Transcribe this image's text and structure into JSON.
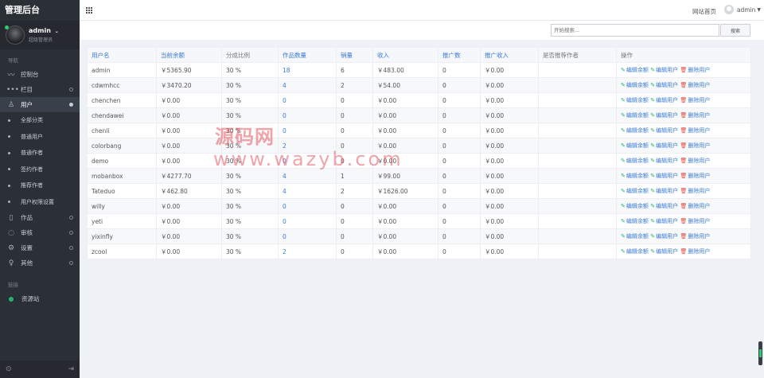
{
  "sidebar": {
    "brand": "管理后台",
    "profile": {
      "name": "admin",
      "role": "超级管理员"
    },
    "section_nav": "导航",
    "section_links": "链接",
    "items": [
      {
        "label": "控制台",
        "icon": "chart-line-icon"
      },
      {
        "label": "栏目",
        "icon": "dots-icon"
      },
      {
        "label": "用户",
        "icon": "user-icon"
      },
      {
        "label": "作品",
        "icon": "book-icon"
      },
      {
        "label": "审核",
        "icon": "circle-notch-icon"
      },
      {
        "label": "设置",
        "icon": "gear-icon"
      },
      {
        "label": "其他",
        "icon": "bulb-icon"
      }
    ],
    "user_subitems": [
      "全部分类",
      "普通用户",
      "普通作者",
      "签约作者",
      "推荐作者",
      "用户权限设置"
    ],
    "links": [
      {
        "label": "资源站"
      }
    ]
  },
  "topbar": {
    "home": "网站首页",
    "user": "admin"
  },
  "search": {
    "placeholder": "开始搜索...",
    "button": "搜索"
  },
  "table": {
    "headers": [
      "用户名",
      "当前余额",
      "分成比例",
      "作品数量",
      "销量",
      "收入",
      "推广数",
      "推广收入",
      "是否推荐作者",
      "操作"
    ],
    "actions": {
      "edit_balance": "编辑余额",
      "edit_user": "编辑用户",
      "delete_user": "删除用户"
    },
    "rows": [
      {
        "username": "admin",
        "balance": "￥5365.90",
        "ratio": "30 %",
        "works": "18",
        "sales": "6",
        "income": "￥483.00",
        "promo": "0",
        "promo_income": "￥0.00",
        "recommended": ""
      },
      {
        "username": "cdwmhcc",
        "balance": "￥3470.20",
        "ratio": "30 %",
        "works": "4",
        "sales": "2",
        "income": "￥54.00",
        "promo": "0",
        "promo_income": "￥0.00",
        "recommended": ""
      },
      {
        "username": "chenchen",
        "balance": "￥0.00",
        "ratio": "30 %",
        "works": "0",
        "sales": "0",
        "income": "￥0.00",
        "promo": "0",
        "promo_income": "￥0.00",
        "recommended": ""
      },
      {
        "username": "chendawei",
        "balance": "￥0.00",
        "ratio": "30 %",
        "works": "0",
        "sales": "0",
        "income": "￥0.00",
        "promo": "0",
        "promo_income": "￥0.00",
        "recommended": ""
      },
      {
        "username": "chenli",
        "balance": "￥0.00",
        "ratio": "30 %",
        "works": "0",
        "sales": "0",
        "income": "￥0.00",
        "promo": "0",
        "promo_income": "￥0.00",
        "recommended": ""
      },
      {
        "username": "colorbang",
        "balance": "￥0.00",
        "ratio": "30 %",
        "works": "2",
        "sales": "0",
        "income": "￥0.00",
        "promo": "0",
        "promo_income": "￥0.00",
        "recommended": ""
      },
      {
        "username": "demo",
        "balance": "￥0.00",
        "ratio": "30 %",
        "works": "0",
        "sales": "0",
        "income": "￥0.00",
        "promo": "0",
        "promo_income": "￥0.00",
        "recommended": ""
      },
      {
        "username": "mobanbox",
        "balance": "￥4277.70",
        "ratio": "30 %",
        "works": "4",
        "sales": "1",
        "income": "￥99.00",
        "promo": "0",
        "promo_income": "￥0.00",
        "recommended": ""
      },
      {
        "username": "Tateduo",
        "balance": "￥462.80",
        "ratio": "30 %",
        "works": "4",
        "sales": "2",
        "income": "￥1626.00",
        "promo": "0",
        "promo_income": "￥0.00",
        "recommended": ""
      },
      {
        "username": "willy",
        "balance": "￥0.00",
        "ratio": "30 %",
        "works": "0",
        "sales": "0",
        "income": "￥0.00",
        "promo": "0",
        "promo_income": "￥0.00",
        "recommended": ""
      },
      {
        "username": "yeti",
        "balance": "￥0.00",
        "ratio": "30 %",
        "works": "0",
        "sales": "0",
        "income": "￥0.00",
        "promo": "0",
        "promo_income": "￥0.00",
        "recommended": ""
      },
      {
        "username": "yixinfly",
        "balance": "￥0.00",
        "ratio": "30 %",
        "works": "0",
        "sales": "0",
        "income": "￥0.00",
        "promo": "0",
        "promo_income": "￥0.00",
        "recommended": ""
      },
      {
        "username": "zcool",
        "balance": "￥0.00",
        "ratio": "30 %",
        "works": "2",
        "sales": "0",
        "income": "￥0.00",
        "promo": "0",
        "promo_income": "￥0.00",
        "recommended": ""
      }
    ]
  },
  "watermark": {
    "line1": "源码网",
    "line2": "www.wazyb.com"
  },
  "colors": {
    "sidebar_bg": "#2b3037",
    "link": "#3a7bd5",
    "edit_icon": "#26b36b",
    "delete_icon": "#e0493b",
    "online": "#2ecc71"
  }
}
